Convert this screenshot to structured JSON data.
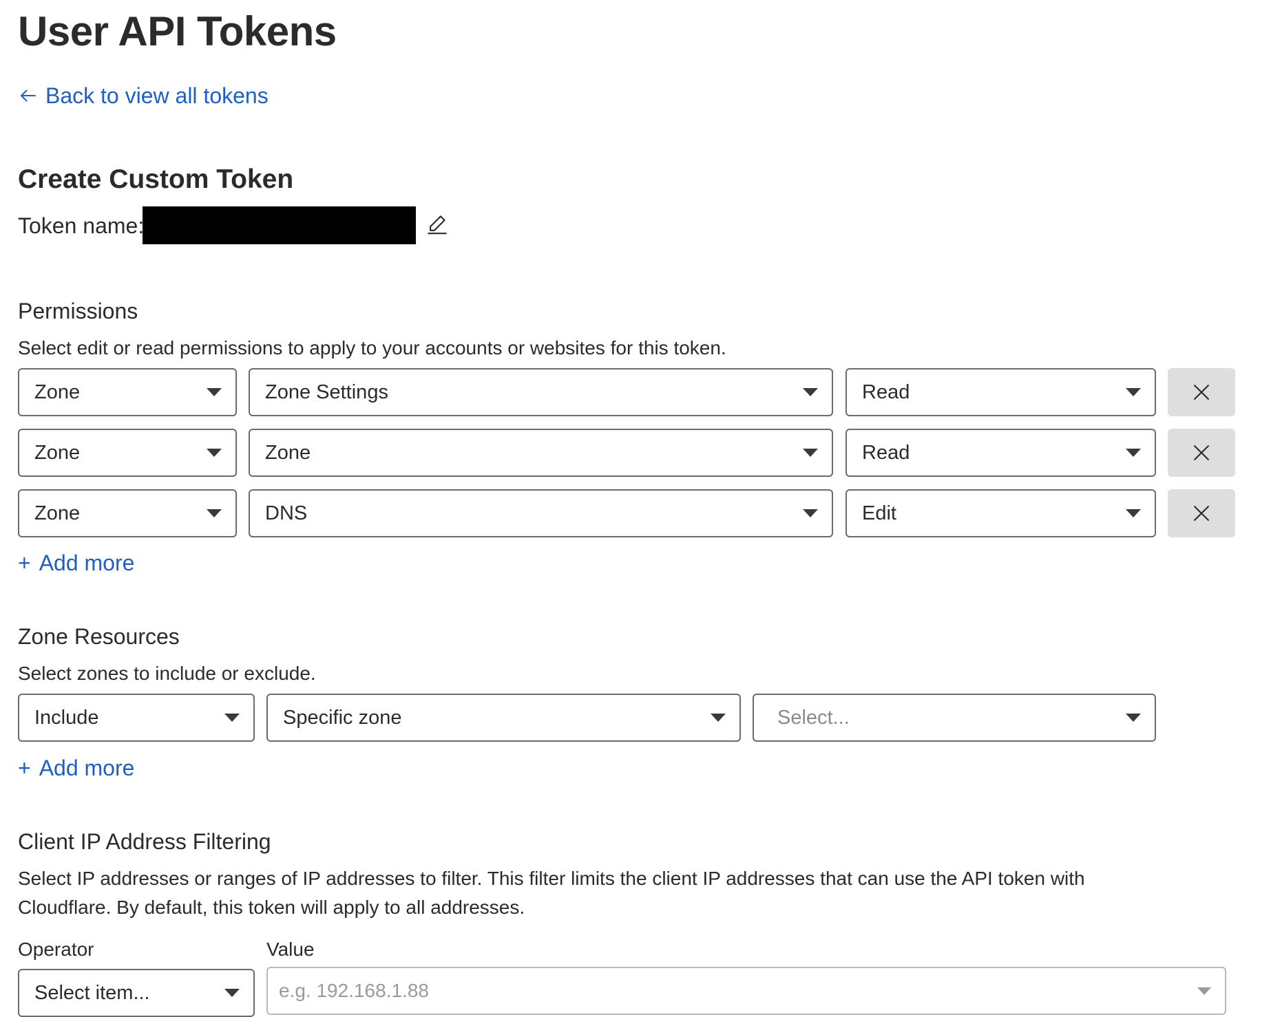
{
  "header": {
    "title": "User API Tokens",
    "back_link": "Back to view all tokens",
    "back_icon": "arrow-left-icon"
  },
  "token": {
    "heading": "Create Custom Token",
    "name_label": "Token name:",
    "name_redacted": true,
    "edit_icon": "pencil-icon"
  },
  "permissions": {
    "title": "Permissions",
    "description": "Select edit or read permissions to apply to your accounts or websites for this token.",
    "rows": [
      {
        "scope": "Zone",
        "resource": "Zone Settings",
        "access": "Read",
        "remove_icon": "close-icon"
      },
      {
        "scope": "Zone",
        "resource": "Zone",
        "access": "Read",
        "remove_icon": "close-icon"
      },
      {
        "scope": "Zone",
        "resource": "DNS",
        "access": "Edit",
        "remove_icon": "close-icon"
      }
    ],
    "add_more": "Add more"
  },
  "zone_resources": {
    "title": "Zone Resources",
    "description": "Select zones to include or exclude.",
    "include": "Include",
    "type": "Specific zone",
    "zone_placeholder": "Select...",
    "add_more": "Add more"
  },
  "ip_filtering": {
    "title": "Client IP Address Filtering",
    "description": "Select IP addresses or ranges of IP addresses to filter. This filter limits the client IP addresses that can use the API token with Cloudflare. By default, this token will apply to all addresses.",
    "operator_label": "Operator",
    "operator_placeholder": "Select item...",
    "value_label": "Value",
    "value_placeholder": "e.g. 192.168.1.88"
  },
  "colors": {
    "link": "#1f5fc4",
    "text": "#2b2b2b",
    "border": "#6b6b6b",
    "remove_button_bg": "#dedede"
  }
}
